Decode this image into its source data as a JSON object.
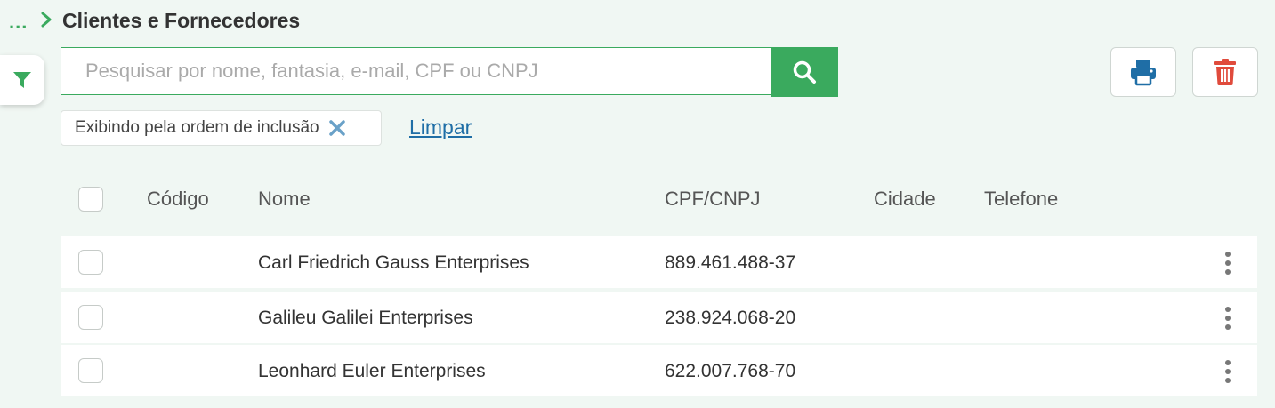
{
  "breadcrumb": {
    "dots": "...",
    "title": "Clientes e Fornecedores"
  },
  "search": {
    "placeholder": "Pesquisar por nome, fantasia, e-mail, CPF ou CNPJ",
    "value": ""
  },
  "filter_chip": {
    "label": "Exibindo pela ordem de inclusão"
  },
  "clear_link": "Limpar",
  "table": {
    "columns": [
      "Código",
      "Nome",
      "CPF/CNPJ",
      "Cidade",
      "Telefone"
    ],
    "rows": [
      {
        "code": "",
        "name": "Carl Friedrich Gauss Enterprises",
        "doc": "889.461.488-37",
        "city": "",
        "phone": ""
      },
      {
        "code": "",
        "name": "Galileu Galilei Enterprises",
        "doc": "238.924.068-20",
        "city": "",
        "phone": ""
      },
      {
        "code": "",
        "name": "Leonhard Euler Enterprises",
        "doc": "622.007.768-70",
        "city": "",
        "phone": ""
      }
    ]
  },
  "icons": {
    "breadcrumb": "chevron-right-icon",
    "filter": "filter-icon",
    "search": "search-icon",
    "print": "print-icon",
    "delete": "trash-icon",
    "chip_remove": "close-icon",
    "row_menu": "kebab-menu-icon"
  },
  "colors": {
    "accent": "#3aaa5e",
    "print": "#1f6ea6",
    "delete": "#e04b3c",
    "link": "#1f6ea6",
    "background": "#f0f7f3"
  }
}
